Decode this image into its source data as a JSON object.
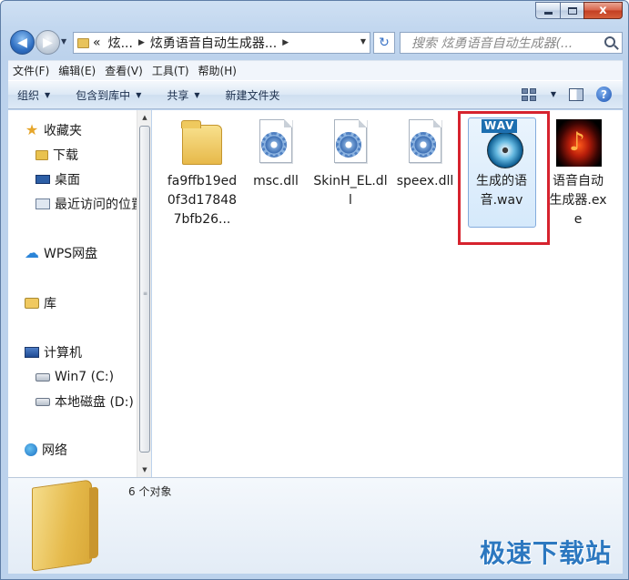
{
  "window": {
    "controls": {
      "minimize": "",
      "maximize": "",
      "close": "x"
    }
  },
  "address": {
    "prefix": "«",
    "segments": [
      "炫...",
      "炫勇语音自动生成器..."
    ],
    "placeholder_search": "搜索 炫勇语音自动生成器(..."
  },
  "menu": [
    "文件(F)",
    "编辑(E)",
    "查看(V)",
    "工具(T)",
    "帮助(H)"
  ],
  "toolbar": {
    "organize": "组织",
    "include_library": "包含到库中",
    "share": "共享",
    "new_folder": "新建文件夹"
  },
  "nav": {
    "favorites": "收藏夹",
    "downloads": "下载",
    "desktop": "桌面",
    "recent": "最近访问的位置",
    "wps": "WPS网盘",
    "library": "库",
    "computer": "计算机",
    "drive_c": "Win7 (C:)",
    "drive_d": "本地磁盘 (D:)",
    "network": "网络"
  },
  "files": [
    {
      "name": "fa9ffb19ed0f3d178487bfb26...",
      "icon": "folder-icon"
    },
    {
      "name": "msc.dll",
      "icon": "dll-gear-icon"
    },
    {
      "name": "SkinH_EL.dll",
      "icon": "dll-gear-icon"
    },
    {
      "name": "speex.dll",
      "icon": "dll-gear-icon"
    },
    {
      "name": "生成的语音.wav",
      "icon": "wav-audio-icon",
      "wav_badge": "WAV"
    },
    {
      "name": "语音自动生成器.exe",
      "icon": "exe-flame-icon",
      "glyph": "♪"
    }
  ],
  "details": {
    "count": "6 个对象"
  },
  "watermark": "极速下载站",
  "colors": {
    "highlight": "#d6232e",
    "selection": "#d5e9fb",
    "accent": "#2c78c0"
  }
}
